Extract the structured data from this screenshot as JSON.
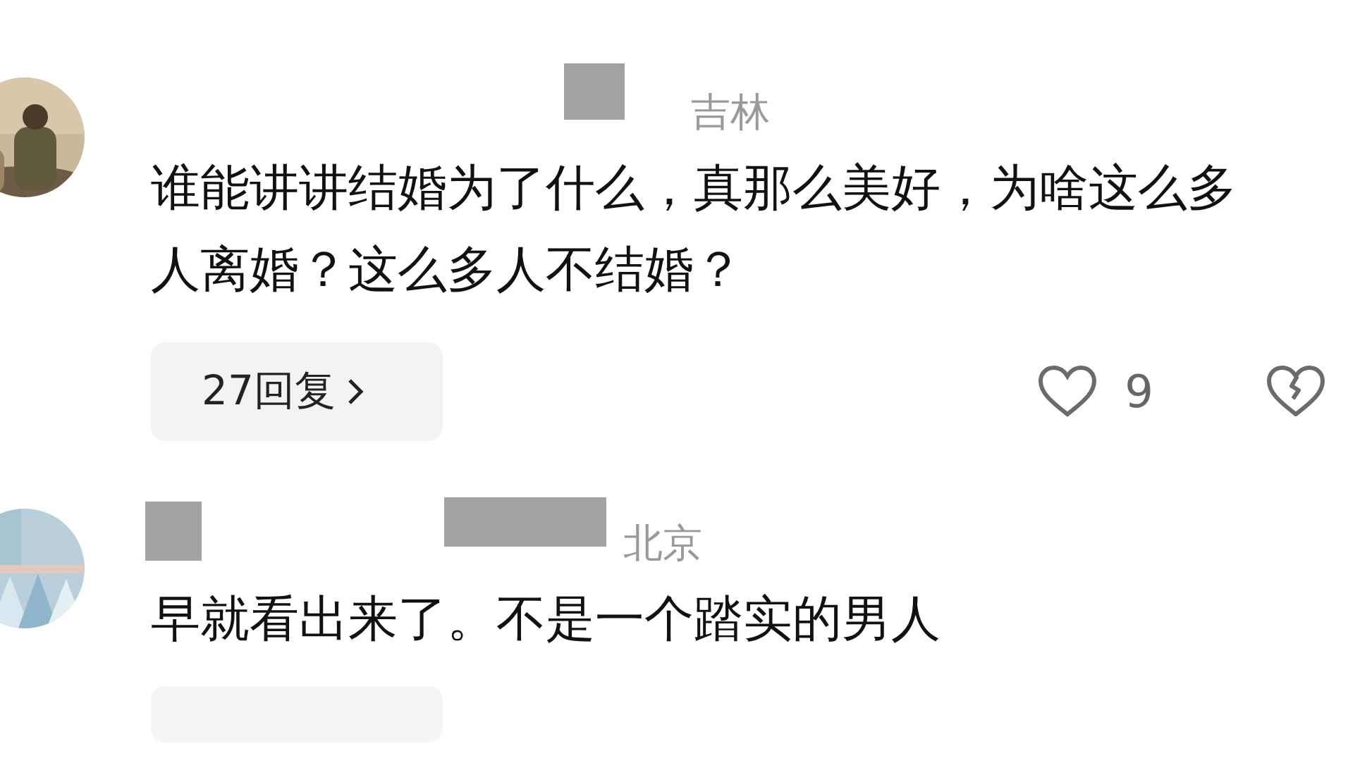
{
  "comments": [
    {
      "location": "吉林",
      "text": "谁能讲讲结婚为了什么，真那么美好，为啥这么多人离婚？这么多人不结婚？",
      "reply_count": "27回复",
      "likes": "9"
    },
    {
      "location": "北京",
      "text": "早就看出来了。不是一个踏实的男人"
    }
  ]
}
